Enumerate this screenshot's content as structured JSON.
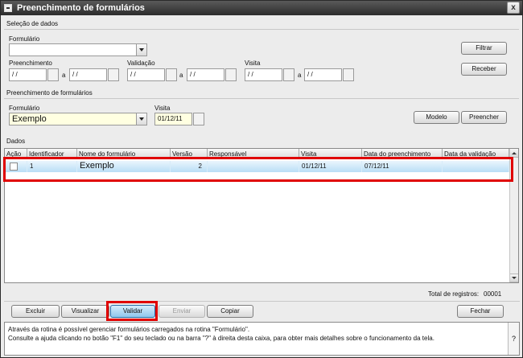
{
  "window": {
    "title": "Preenchimento de formulários",
    "close_glyph": "x"
  },
  "selecao": {
    "section_title": "Seleção de dados",
    "formulario_label": "Formulário",
    "formulario_value": "",
    "preenchimento_label": "Preenchimento",
    "validacao_label": "Validação",
    "visita_label": "Visita",
    "date_placeholder": "/ /",
    "a_label": "a",
    "filtrar_button": "Filtrar",
    "receber_button": "Receber"
  },
  "preenchimento": {
    "section_title": "Preenchimento de formulários",
    "formulario_label": "Formulário",
    "formulario_value": "Exemplo",
    "visita_label": "Visita",
    "visita_value": "01/12/11",
    "modelo_button": "Modelo",
    "preencher_button": "Preencher"
  },
  "dados": {
    "section_title": "Dados",
    "columns": [
      "Ação",
      "Identificador",
      "Nome do formulário",
      "Versão",
      "Responsável",
      "Visita",
      "Data do preenchimento",
      "Data da validação"
    ],
    "rows": [
      {
        "acao": "",
        "identificador": "1",
        "nome": "Exemplo",
        "versao": "2",
        "responsavel": "",
        "visita": "01/12/11",
        "data_preenchimento": "07/12/11",
        "data_validacao": ""
      }
    ],
    "total_label": "Total de registros:",
    "total_value": "00001"
  },
  "actions": {
    "excluir": "Excluir",
    "visualizar": "Visualizar",
    "validar": "Validar",
    "enviar": "Enviar",
    "copiar": "Copiar",
    "fechar": "Fechar"
  },
  "help": {
    "line1": "Através da rotina é possível gerenciar formulários carregados na rotina \"Formulário\".",
    "line2": "Consulte a ajuda clicando no botão \"F1\" do seu teclado ou na barra \"?\" à direita desta caixa, para obter mais detalhes sobre o funcionamento da tela.",
    "help_glyph": "?"
  },
  "colors": {
    "highlight": "#e00000",
    "row_selected": "#b9def6",
    "yellow_field": "#ffffe1"
  }
}
